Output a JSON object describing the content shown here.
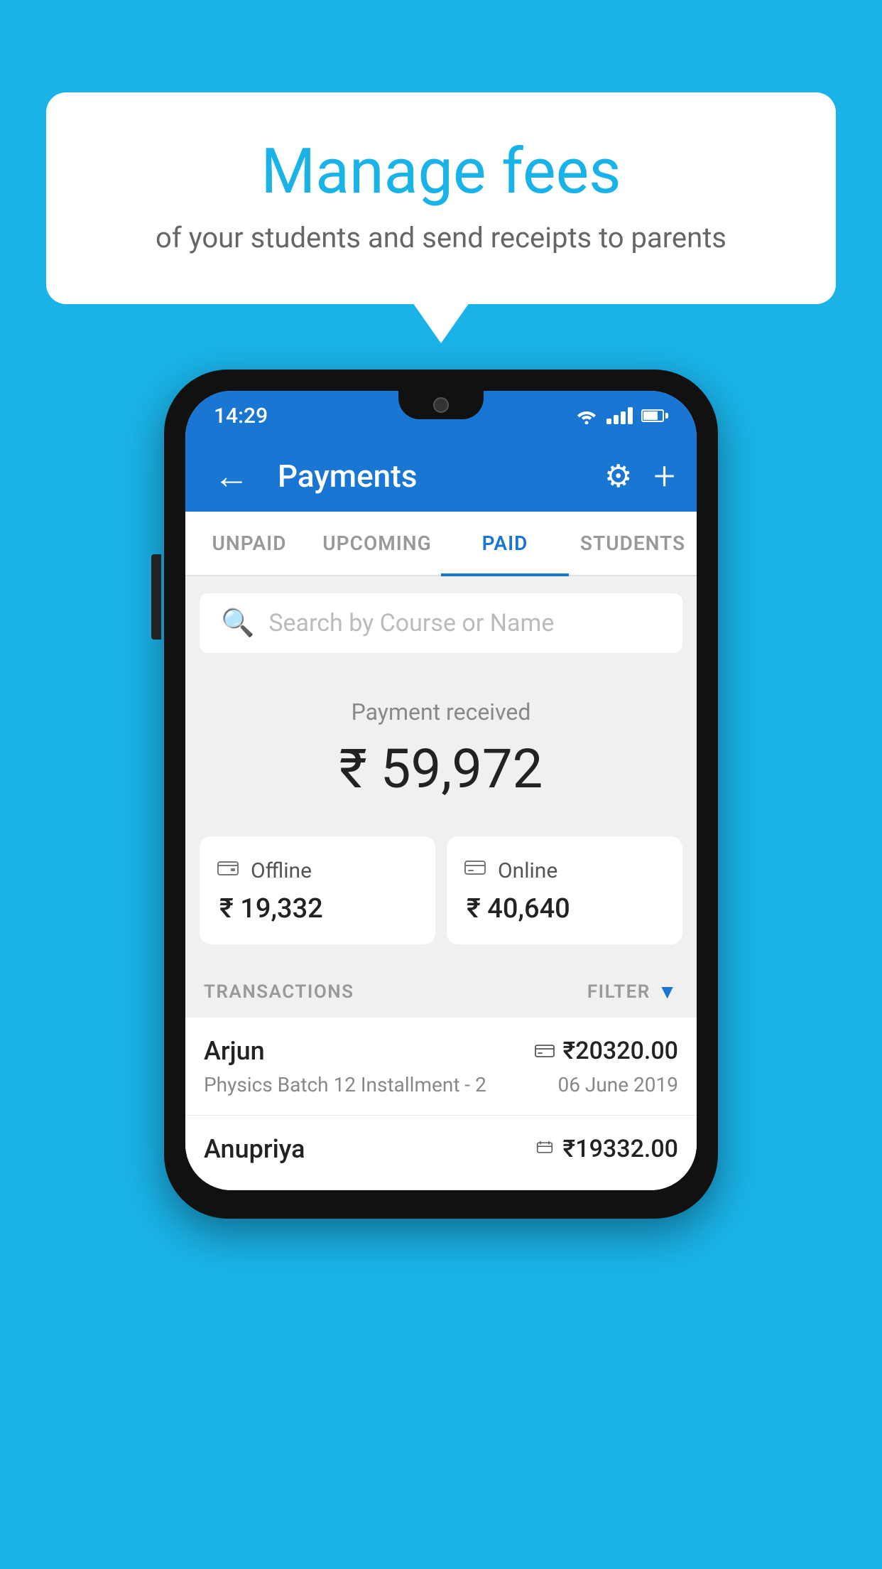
{
  "background_color": "#1ab3e8",
  "speech_bubble": {
    "title": "Manage fees",
    "subtitle": "of your students and send receipts to parents"
  },
  "status_bar": {
    "time": "14:29",
    "wifi": true,
    "signal": true,
    "battery": true
  },
  "toolbar": {
    "title": "Payments",
    "back_label": "←",
    "settings_label": "⚙",
    "add_label": "+"
  },
  "tabs": [
    {
      "id": "unpaid",
      "label": "UNPAID",
      "active": false
    },
    {
      "id": "upcoming",
      "label": "UPCOMING",
      "active": false
    },
    {
      "id": "paid",
      "label": "PAID",
      "active": true
    },
    {
      "id": "students",
      "label": "STUDENTS",
      "active": false
    }
  ],
  "search": {
    "placeholder": "Search by Course or Name"
  },
  "payment_received": {
    "label": "Payment received",
    "amount": "₹ 59,972"
  },
  "cards": [
    {
      "type": "Offline",
      "icon": "💵",
      "amount": "₹ 19,332"
    },
    {
      "type": "Online",
      "icon": "💳",
      "amount": "₹ 40,640"
    }
  ],
  "transactions_header": {
    "label": "TRANSACTIONS",
    "filter_label": "FILTER"
  },
  "transactions": [
    {
      "name": "Arjun",
      "description": "Physics Batch 12 Installment - 2",
      "amount": "₹20320.00",
      "date": "06 June 2019",
      "mode": "online"
    },
    {
      "name": "Anupriya",
      "description": "",
      "amount": "₹19332.00",
      "date": "",
      "mode": "offline"
    }
  ]
}
